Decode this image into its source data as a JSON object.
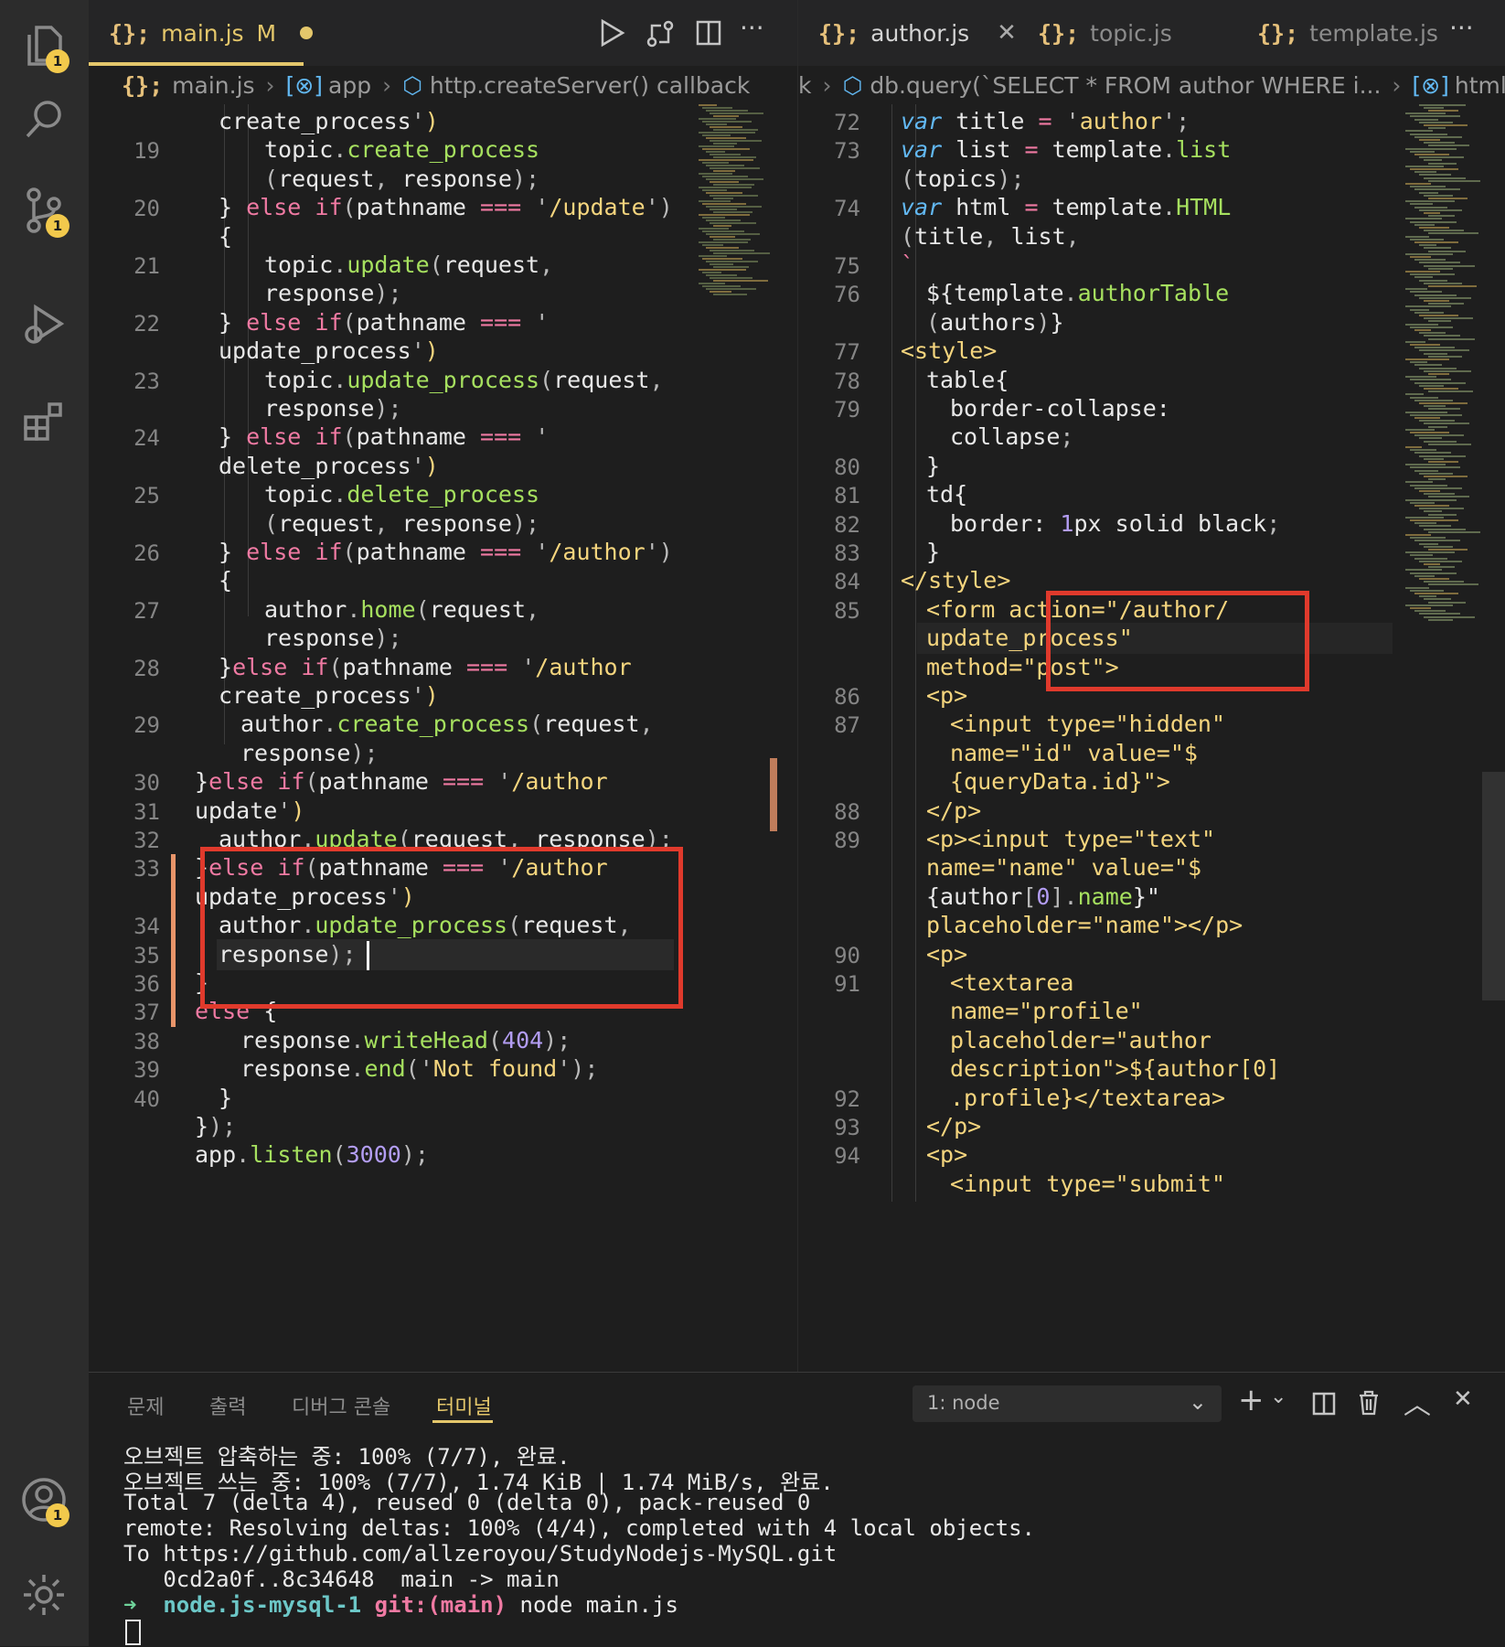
{
  "activity": {
    "explorer_badge": "1",
    "scm_badge": "1",
    "account_badge": "1"
  },
  "left": {
    "tab": {
      "name": "main.js",
      "status": "M"
    },
    "breadcrumb": {
      "file": "main.js",
      "symbol1": "app",
      "symbol2": "http.createServer() callback"
    },
    "line_numbers": [
      "19",
      "20",
      "21",
      "22",
      "23",
      "24",
      "25",
      "26",
      "27",
      "28",
      "29",
      "30",
      "31",
      "32",
      "33",
      "34",
      "35",
      "36",
      "37",
      "38",
      "39",
      "40"
    ],
    "code": [
      "create_process'){",
      "topic.create_process",
      "(request, response);",
      "} else if(pathname === '/update')",
      "{",
      "topic.update(request,",
      "response);",
      "} else if(pathname === '/",
      "update_process'){",
      "topic.update_process(request,",
      "response);",
      "} else if(pathname === '/",
      "delete_process'){",
      "topic.delete_process",
      "(request, response);",
      "} else if(pathname === '/author')",
      "{",
      "author.home(request,",
      "response);",
      "}else if(pathname === '/author/",
      "create_process'){",
      "author.create_process(request,",
      "response);",
      "}else if(pathname === '/author/",
      "update'){",
      "author.update(request, response);",
      "}else if(pathname === '/author/",
      "update_process'){",
      "author.update_process(request,",
      "response);",
      "}",
      "else {",
      "response.writeHead(404);",
      "response.end('Not found');",
      "}",
      "});",
      "app.listen(3000);"
    ]
  },
  "right": {
    "tabs": [
      {
        "name": "author.js"
      },
      {
        "name": "topic.js"
      },
      {
        "name": "template.js"
      }
    ],
    "breadcrumb": {
      "prefix": "k",
      "symbol1": "db.query(`SELECT * FROM author WHERE i...",
      "symbol2": "html"
    },
    "line_numbers": [
      "72",
      "73",
      "74",
      "75",
      "76",
      "77",
      "78",
      "79",
      "80",
      "81",
      "82",
      "83",
      "84",
      "85",
      "86",
      "87",
      "88",
      "89",
      "90",
      "91",
      "92",
      "93",
      "94"
    ],
    "code": [
      "var title = 'author';",
      "var list = template.list",
      "(topics);",
      "var html = template.HTML",
      "(title, list,",
      "`",
      "${template.authorTable",
      "(authors)}",
      "<style>",
      "table{",
      "border-collapse:",
      "collapse;",
      "}",
      "td{",
      "border: 1px solid black;",
      "}",
      "</style>",
      "<form action=\"/author/",
      "update_process\"",
      "method=\"post\">",
      "<p>",
      "<input type=\"hidden\"",
      "name=\"id\" value=\"$",
      "{queryData.id}\">",
      "</p>",
      "<p><input type=\"text\"",
      "name=\"name\" value=\"$",
      "{author[0].name}\"",
      "placeholder=\"name\"></p>",
      "<p>",
      "<textarea",
      "name=\"profile\"",
      "placeholder=\"author",
      "description\">${author[0]",
      ".profile}</textarea>",
      "</p>",
      "<p>",
      "<input type=\"submit\""
    ]
  },
  "panel": {
    "tabs": [
      "문제",
      "출력",
      "디버그 콘솔",
      "터미널"
    ],
    "terminal_select": "1: node",
    "terminal_lines": [
      "오브젝트 압축하는 중: 100% (7/7), 완료.",
      "오브젝트 쓰는 중: 100% (7/7), 1.74 KiB | 1.74 MiB/s, 완료.",
      "Total 7 (delta 4), reused 0 (delta 0), pack-reused 0",
      "remote: Resolving deltas: 100% (4/4), completed with 4 local objects.",
      "To https://github.com/allzeroyou/StudyNodejs-MySQL.git",
      "   0cd2a0f..8c34648  main -> main"
    ],
    "prompt": {
      "arrow": "➜",
      "dir": "node.js-mysql-1",
      "git": "git:(main)",
      "cmd": "node main.js"
    }
  }
}
